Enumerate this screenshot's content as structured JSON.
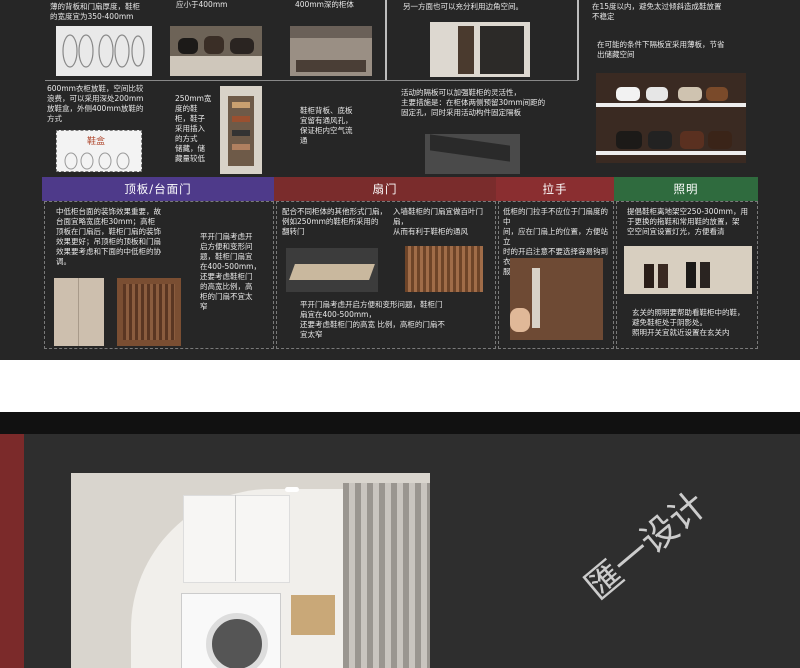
{
  "top_texts": {
    "t1": "薄的背板和门扇厚度，鞋柜\n的宽度宜为350-400mm",
    "t2": "应小于400mm",
    "t3": "400mm深的柜体",
    "t4": "另一方面也可以充分利用边角空间。",
    "t5": "在15度以内，避免太过倾斜造成鞋放置\n不稳定",
    "t6": "在可能的条件下隔板宜采用薄板，节省\n出储藏空间",
    "t7": "600mm衣柜放鞋，空间比较\n浪费，可以采用深处200mm\n放鞋盒，外侧400mm放鞋的\n方式",
    "t8": "250mm宽\n度的鞋\n柜，鞋子\n采用插入\n的方式\n储藏，储\n藏量较低",
    "t9": "鞋柜背板、底板\n宜留有通风孔，\n保证柜内空气流\n通",
    "t10": "活动的隔板可以加强鞋柜的灵活性，\n主要措施是：在柜体两侧预留30mm间距的\n固定孔，同时采用活动构件固定隔板",
    "shoebox_label": "鞋盒"
  },
  "bands": [
    {
      "label": "顶板/台面门",
      "color": "#4e3a8a"
    },
    {
      "label": "扇门",
      "color": "#7a2c2c"
    },
    {
      "label": "拉手",
      "color": "#8a2e30"
    },
    {
      "label": "照明",
      "color": "#2f6b3e"
    }
  ],
  "bottom_texts": {
    "b1": "中低柜台面的装饰效果重要，故\n台面宜略宽底柜30mm；高柜\n顶板在门扇后，鞋柜门扇的装饰\n效果更好；吊顶柜的顶板和门扇\n效果要考虑和下面的中低柜的协\n调。",
    "b2": "平开门扇考虑开\n启方便和变形问\n题，鞋柜门扇宜\n在400-500mm，\n还要考虑鞋柜门\n的高宽比例，高\n柜的门扇不宜太\n窄",
    "b3": "配合不同柜体的其他形式门扇，\n例如250mm的鞋柜所采用的\n翻转门",
    "b4": "入墙鞋柜的门扇宜做百叶门扇，\n从而有利于鞋柜的通风",
    "b5": "平开门扇考虑开启方便和变形问题，鞋柜门\n扇宜在400-500mm，\n还要考虑鞋柜门的高宽 比例，高柜的门扇不\n宜太窄",
    "b6": "低柜的门拉手不应位于门扇度的中\n间，应在门扇上的位置，方便站立\n时的开启注意不要选择容易钩到衣\n服的拉手",
    "b7": "提倡鞋柜离地架空250-300mm，用\n于更换的拖鞋和常用鞋的放置，架\n空空间宜设置灯光，方便看清",
    "b8": "玄关的照明要帮助看鞋柜中的鞋，\n避免鞋柜处于阴影处。\n照明开关宜就近设置在玄关内"
  },
  "watermark": "匯一设计",
  "colors": {
    "panel_bg": "#262626",
    "accent_red": "#7b2a2a",
    "white": "#ffffff"
  }
}
